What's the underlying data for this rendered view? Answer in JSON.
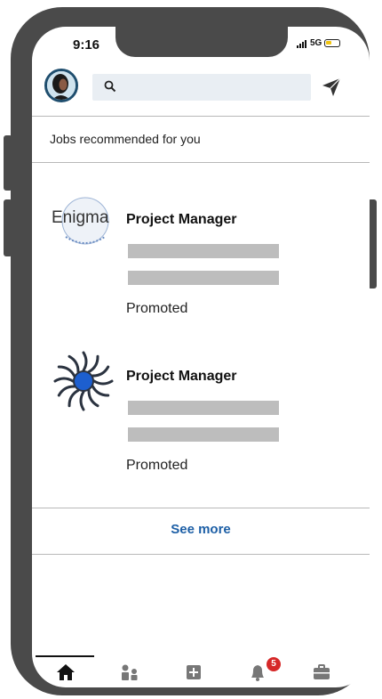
{
  "status_bar": {
    "time": "9:16",
    "network": "5G"
  },
  "header": {
    "search_placeholder": ""
  },
  "section": {
    "title": "Jobs recommended for you"
  },
  "jobs": [
    {
      "company": "Enigma",
      "title": "Project Manager",
      "tag": "Promoted"
    },
    {
      "company": "",
      "title": "Project Manager",
      "tag": "Promoted"
    }
  ],
  "see_more": "See more",
  "bottom_nav": {
    "items": [
      "home",
      "network",
      "post",
      "notifications",
      "jobs"
    ],
    "notifications_count": "5"
  },
  "colors": {
    "frame": "#4a4a4a",
    "link": "#1d5fa6",
    "badge": "#d62828",
    "placeholder": "#bdbdbd"
  }
}
